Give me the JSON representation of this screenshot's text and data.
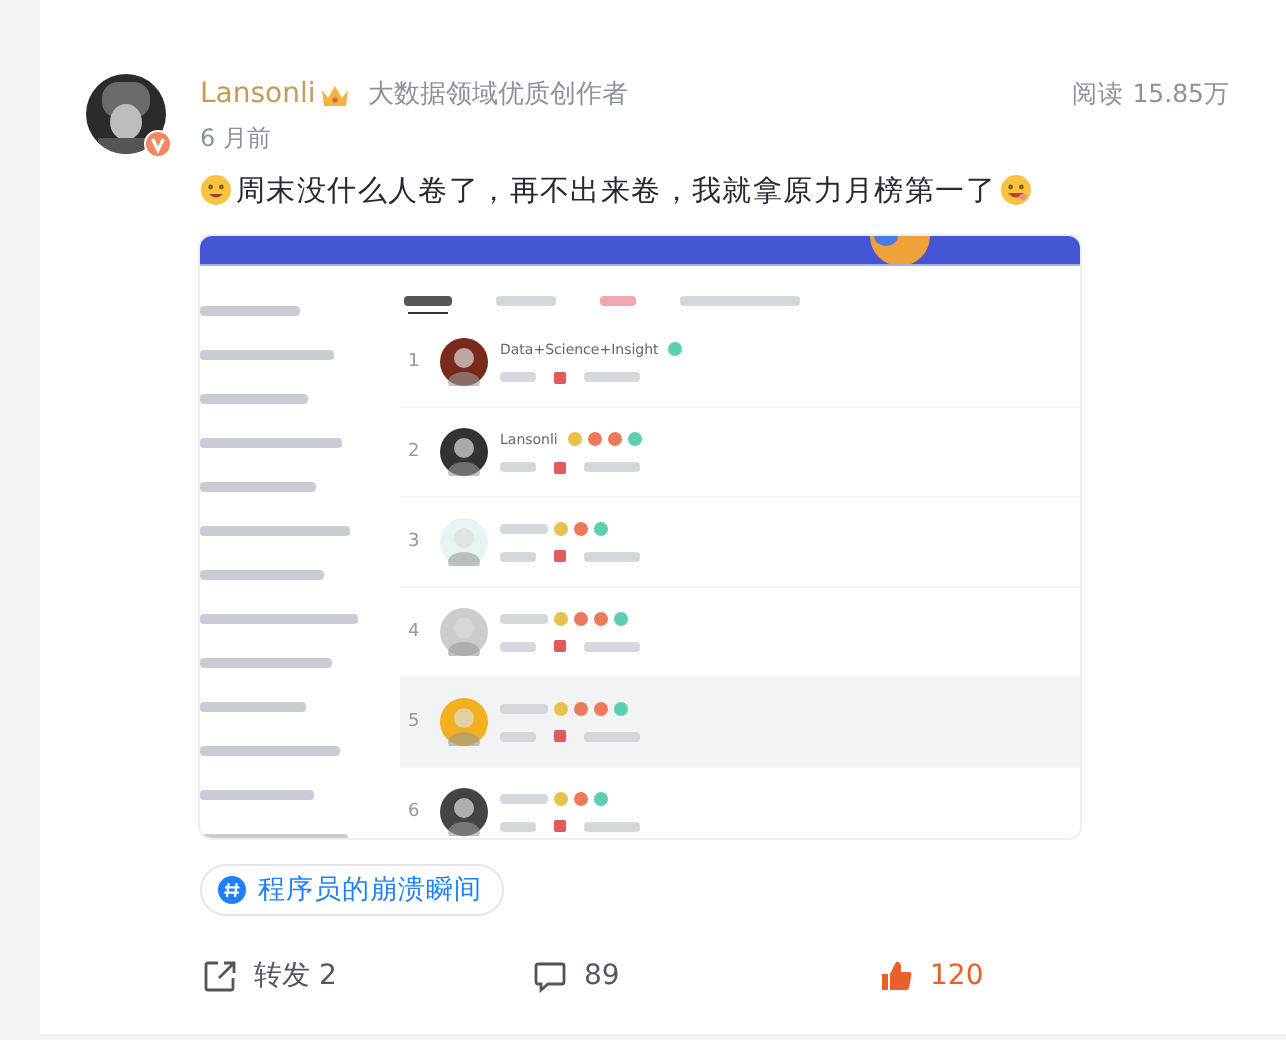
{
  "post": {
    "author": "Lansonli",
    "author_title": "大数据领域优质创作者",
    "reads": "阅读 15.85万",
    "time": "6 月前",
    "text": "周末没什么人卷了，再不出来卷，我就拿原力月榜第一了"
  },
  "embedded_screenshot": {
    "rows": [
      {
        "rank": "1",
        "name": "Data+Science+Insight",
        "highlighted": false,
        "badges": [
          {
            "color": "#5ccfb0"
          }
        ]
      },
      {
        "rank": "2",
        "name": "Lansonli",
        "highlighted": false,
        "badges": [
          {
            "color": "#e8c14a"
          },
          {
            "color": "#ec7a5a"
          },
          {
            "color": "#ec7a5a"
          },
          {
            "color": "#5ccfb0"
          }
        ]
      },
      {
        "rank": "3",
        "highlighted": false,
        "badges": [
          {
            "color": "#e8c14a"
          },
          {
            "color": "#ec7a5a"
          },
          {
            "color": "#5ccfb0"
          }
        ]
      },
      {
        "rank": "4",
        "highlighted": false,
        "badges": [
          {
            "color": "#e8c14a"
          },
          {
            "color": "#ec7a5a"
          },
          {
            "color": "#ec7a5a"
          },
          {
            "color": "#5ccfb0"
          }
        ]
      },
      {
        "rank": "5",
        "highlighted": true,
        "badges": [
          {
            "color": "#e8c14a"
          },
          {
            "color": "#ec7a5a"
          },
          {
            "color": "#ec7a5a"
          },
          {
            "color": "#5ccfb0"
          }
        ]
      },
      {
        "rank": "6",
        "highlighted": false,
        "badges": [
          {
            "color": "#e8c14a"
          },
          {
            "color": "#ec7a5a"
          },
          {
            "color": "#5ccfb0"
          }
        ]
      }
    ]
  },
  "tag": "程序员的崩溃瞬间",
  "actions": [
    {
      "kind": "share",
      "label": "转发 2",
      "active": false
    },
    {
      "kind": "comment",
      "label": "89",
      "active": false
    },
    {
      "kind": "like",
      "label": "120",
      "active": true
    }
  ]
}
